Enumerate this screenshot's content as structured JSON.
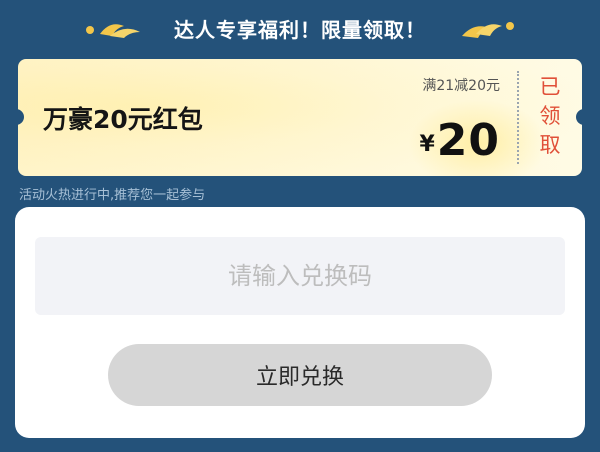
{
  "header": {
    "title": "达人专享福利！限量领取！"
  },
  "coupon": {
    "name": "万豪20元红包",
    "condition": "满21减20元",
    "currency": "¥",
    "value": "20",
    "status": [
      "已",
      "领",
      "取"
    ]
  },
  "hint": "活动火热进行中,推荐您一起参与",
  "redeem": {
    "placeholder": "请输入兑换码",
    "button_label": "立即兑换"
  },
  "colors": {
    "background": "#24527a",
    "status_red": "#e05038",
    "coupon_bg": "#fffbe6",
    "button_gray": "#d6d6d6",
    "input_bg": "#f2f3f7"
  }
}
